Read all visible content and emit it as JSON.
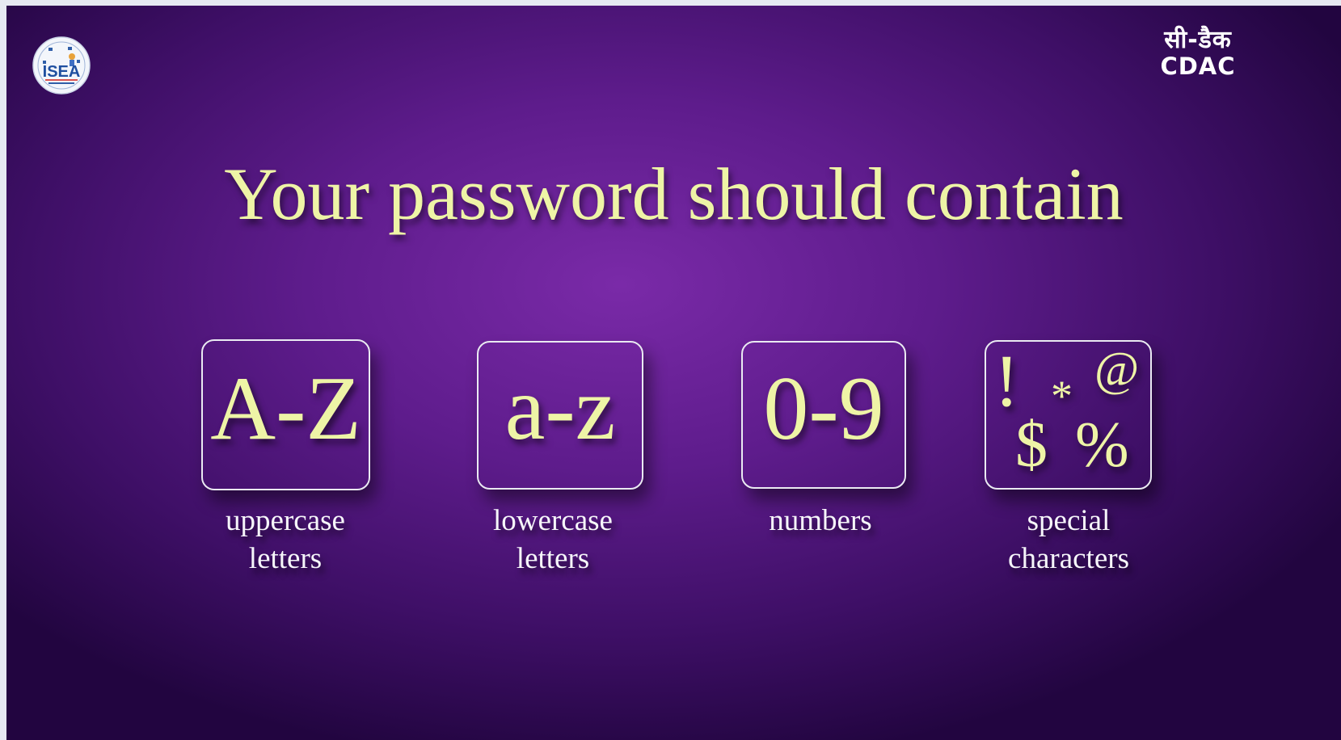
{
  "slide": {
    "title": "Your password should contain"
  },
  "logos": {
    "isea_text": "ISEA",
    "cdac_hindi": "सी-डैक",
    "cdac_latin": "CDAC"
  },
  "requirements": [
    {
      "glyphs": "A-Z",
      "label_line1": "uppercase",
      "label_line2": "letters"
    },
    {
      "glyphs": "a-z",
      "label_line1": "lowercase",
      "label_line2": "letters"
    },
    {
      "glyphs": "0-9",
      "label_line1": "numbers",
      "label_line2": ""
    },
    {
      "symbols": [
        "!",
        "*",
        "@",
        "$",
        "%"
      ],
      "label_line1": "special",
      "label_line2": "characters"
    }
  ],
  "colors": {
    "title_text": "#eef4a6",
    "label_text": "#f6f6fa",
    "box_border": "#eaeaf2",
    "background_center": "#7a2aa8",
    "background_edge": "#220540"
  }
}
